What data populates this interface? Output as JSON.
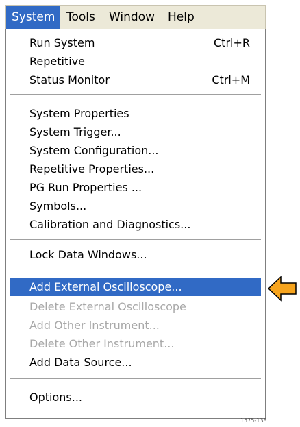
{
  "menubar": {
    "items": [
      {
        "label": "System",
        "active": true
      },
      {
        "label": "Tools"
      },
      {
        "label": "Window"
      },
      {
        "label": "Help"
      }
    ]
  },
  "menu": {
    "items": [
      {
        "label": "Run System",
        "shortcut": "Ctrl+R"
      },
      {
        "label": "Repetitive"
      },
      {
        "label": "Status Monitor",
        "shortcut": "Ctrl+M"
      },
      {
        "label": "System Properties"
      },
      {
        "label": "System Trigger..."
      },
      {
        "label": "System Configuration..."
      },
      {
        "label": "Repetitive Properties..."
      },
      {
        "label": "PG Run Properties ..."
      },
      {
        "label": "Symbols..."
      },
      {
        "label": "Calibration and Diagnostics..."
      },
      {
        "label": "Lock Data Windows..."
      },
      {
        "label": "Add External Oscilloscope...",
        "highlighted": true
      },
      {
        "label": "Delete External Oscilloscope",
        "disabled": true
      },
      {
        "label": "Add Other Instrument...",
        "disabled": true
      },
      {
        "label": "Delete Other Instrument...",
        "disabled": true
      },
      {
        "label": "Add Data Source..."
      },
      {
        "label": "Options..."
      }
    ]
  },
  "figure_number": "1575-138",
  "colors": {
    "highlight": "#316ac5",
    "menubar_bg": "#ece9d8",
    "disabled_text": "#a8a8a8",
    "arrow_fill": "#f7a41d"
  },
  "icons": {
    "pointer": "left-arrow-icon"
  }
}
